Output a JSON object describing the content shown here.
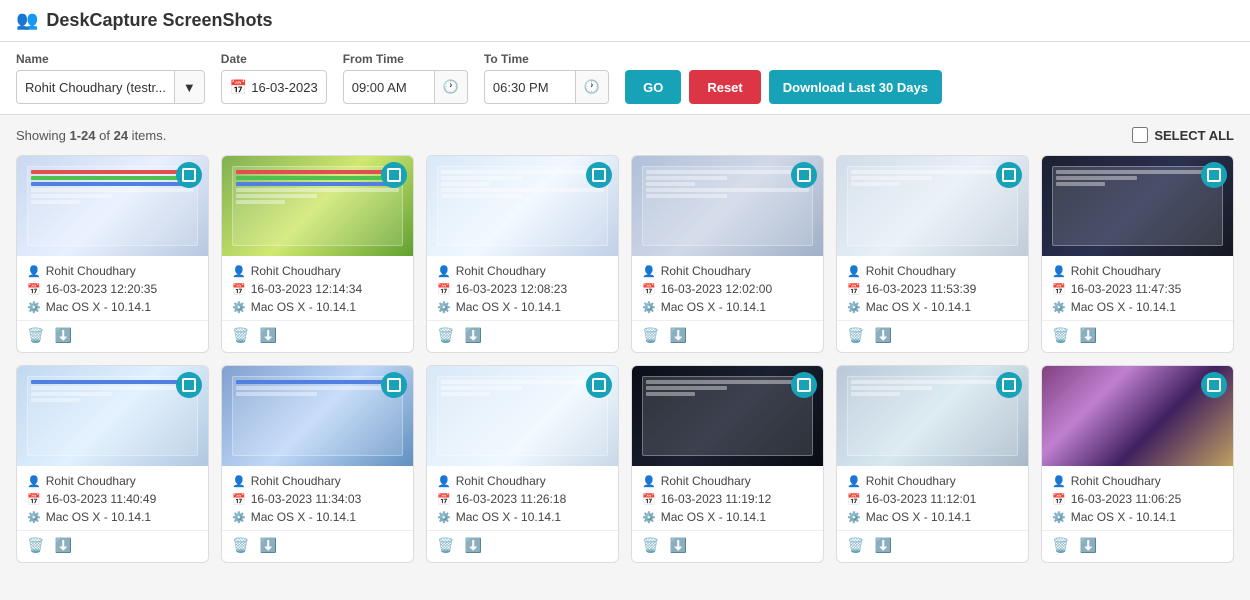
{
  "app": {
    "title": "DeskCapture ScreenShots",
    "icon": "users-icon"
  },
  "filters": {
    "name_label": "Name",
    "date_label": "Date",
    "from_time_label": "From Time",
    "to_time_label": "To Time",
    "name_value": "Rohit Choudhary (testr...",
    "date_value": "16-03-2023",
    "from_time_value": "09:00 AM",
    "to_time_value": "06:30 PM",
    "go_label": "GO",
    "reset_label": "Reset",
    "download_label": "Download Last 30 Days"
  },
  "showing": {
    "text_prefix": "Showing ",
    "range": "1-24",
    "of": " of ",
    "total": "24",
    "text_suffix": " items.",
    "select_all_label": "SELECT ALL"
  },
  "cards": [
    {
      "name": "Rohit Choudhary",
      "datetime": "16-03-2023 12:20:35",
      "os": "Mac OS X - 10.14.1",
      "theme": "light"
    },
    {
      "name": "Rohit Choudhary",
      "datetime": "16-03-2023 12:14:34",
      "os": "Mac OS X - 10.14.1",
      "theme": "colorful"
    },
    {
      "name": "Rohit Choudhary",
      "datetime": "16-03-2023 12:08:23",
      "os": "Mac OS X - 10.14.1",
      "theme": "light2"
    },
    {
      "name": "Rohit Choudhary",
      "datetime": "16-03-2023 12:02:00",
      "os": "Mac OS X - 10.14.1",
      "theme": "medium"
    },
    {
      "name": "Rohit Choudhary",
      "datetime": "16-03-2023 11:53:39",
      "os": "Mac OS X - 10.14.1",
      "theme": "light3"
    },
    {
      "name": "Rohit Choudhary",
      "datetime": "16-03-2023 11:47:35",
      "os": "Mac OS X - 10.14.1",
      "theme": "dark2"
    },
    {
      "name": "Rohit Choudhary",
      "datetime": "16-03-2023 11:40:49",
      "os": "Mac OS X - 10.14.1",
      "theme": "light4"
    },
    {
      "name": "Rohit Choudhary",
      "datetime": "16-03-2023 11:34:03",
      "os": "Mac OS X - 10.14.1",
      "theme": "colorful2"
    },
    {
      "name": "Rohit Choudhary",
      "datetime": "16-03-2023 11:26:18",
      "os": "Mac OS X - 10.14.1",
      "theme": "light5"
    },
    {
      "name": "Rohit Choudhary",
      "datetime": "16-03-2023 11:19:12",
      "os": "Mac OS X - 10.14.1",
      "theme": "dark3"
    },
    {
      "name": "Rohit Choudhary",
      "datetime": "16-03-2023 11:12:01",
      "os": "Mac OS X - 10.14.1",
      "theme": "medium2"
    },
    {
      "name": "Rohit Choudhary",
      "datetime": "16-03-2023 11:06:25",
      "os": "Mac OS X - 10.14.1",
      "theme": "photo"
    }
  ],
  "colors": {
    "primary": "#17a2b8",
    "danger": "#dc3545",
    "text_muted": "#777"
  }
}
